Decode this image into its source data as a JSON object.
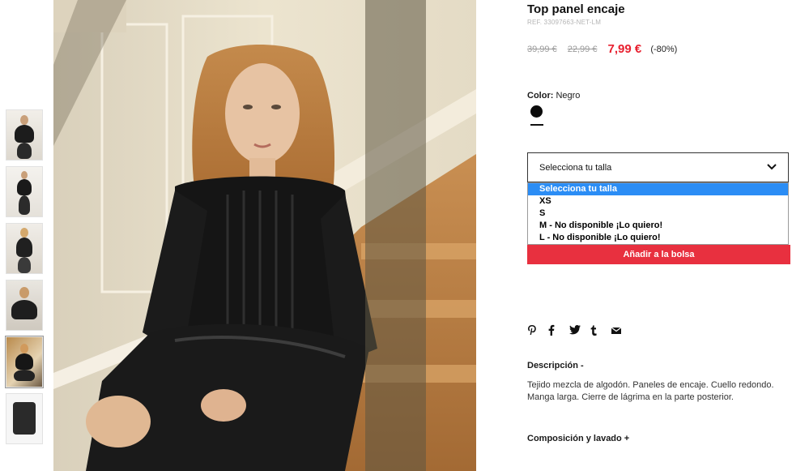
{
  "product": {
    "title": "Top panel encaje",
    "ref": "REF. 33097663-NET-LM",
    "price_original": "39,99 €",
    "price_previous": "22,99 €",
    "price_current": "7,99 €",
    "discount": "(-80%)"
  },
  "color": {
    "label": "Color:",
    "value": "Negro",
    "swatch_hex": "#0b0b0b"
  },
  "size_select": {
    "selected": "Selecciona tu talla",
    "options": [
      "Selecciona tu talla",
      "XS",
      "S",
      "M - No disponible ¡Lo quiero!",
      "L - No disponible ¡Lo quiero!"
    ]
  },
  "add_to_bag": "Añadir a la bolsa",
  "share_icons": [
    "pinterest-icon",
    "facebook-icon",
    "twitter-icon",
    "tumblr-icon",
    "email-icon"
  ],
  "description": {
    "heading": "Descripción -",
    "text": "Tejido mezcla de algodón. Paneles de encaje. Cuello redondo. Manga larga. Cierre de lágrima en la parte posterior."
  },
  "composition": {
    "heading": "Composición y lavado +"
  },
  "colors": {
    "accent_red": "#e8202f",
    "button_red": "#e8303f",
    "select_highlight": "#2b8df5"
  }
}
